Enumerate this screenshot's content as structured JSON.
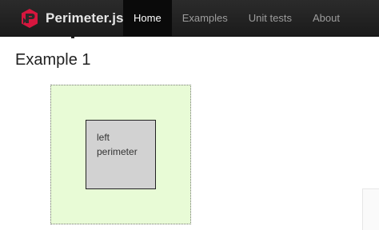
{
  "brand": {
    "name": "Perimeter.js",
    "logo_icon": "perimeter-logo-icon",
    "logo_color": "#d6163e"
  },
  "nav": {
    "items": [
      {
        "label": "Home",
        "active": true
      },
      {
        "label": "Examples",
        "active": false
      },
      {
        "label": "Unit tests",
        "active": false
      },
      {
        "label": "About",
        "active": false
      }
    ]
  },
  "content": {
    "section_title": "Example 1",
    "inner_label": "left perimeter",
    "outer_color": "#e8fbd6",
    "inner_color": "#d2d2d2"
  }
}
